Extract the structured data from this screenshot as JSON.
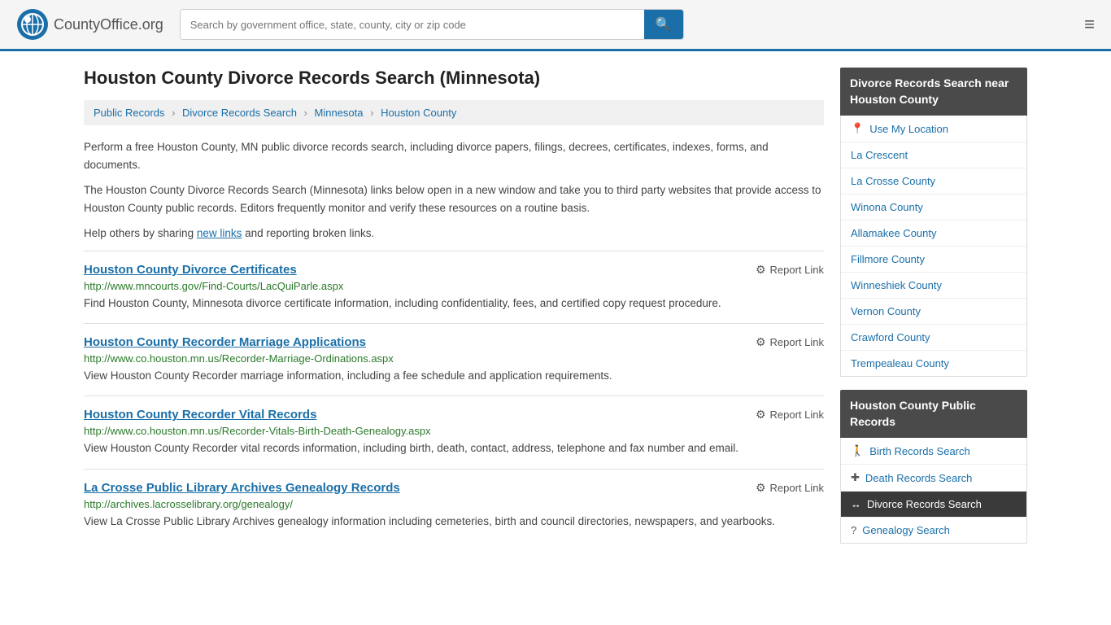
{
  "header": {
    "logo_text": "CountyOffice",
    "logo_suffix": ".org",
    "search_placeholder": "Search by government office, state, county, city or zip code"
  },
  "page": {
    "title": "Houston County Divorce Records Search (Minnesota)",
    "breadcrumb": [
      {
        "label": "Public Records",
        "href": "#"
      },
      {
        "label": "Divorce Records Search",
        "href": "#"
      },
      {
        "label": "Minnesota",
        "href": "#"
      },
      {
        "label": "Houston County",
        "href": "#"
      }
    ],
    "description1": "Perform a free Houston County, MN public divorce records search, including divorce papers, filings, decrees, certificates, indexes, forms, and documents.",
    "description2": "The Houston County Divorce Records Search (Minnesota) links below open in a new window and take you to third party websites that provide access to Houston County public records. Editors frequently monitor and verify these resources on a routine basis.",
    "description3_prefix": "Help others by sharing ",
    "new_links_text": "new links",
    "description3_suffix": " and reporting broken links."
  },
  "records": [
    {
      "title": "Houston County Divorce Certificates",
      "url": "http://www.mncourts.gov/Find-Courts/LacQuiParle.aspx",
      "description": "Find Houston County, Minnesota divorce certificate information, including confidentiality, fees, and certified copy request procedure."
    },
    {
      "title": "Houston County Recorder Marriage Applications",
      "url": "http://www.co.houston.mn.us/Recorder-Marriage-Ordinations.aspx",
      "description": "View Houston County Recorder marriage information, including a fee schedule and application requirements."
    },
    {
      "title": "Houston County Recorder Vital Records",
      "url": "http://www.co.houston.mn.us/Recorder-Vitals-Birth-Death-Genealogy.aspx",
      "description": "View Houston County Recorder vital records information, including birth, death, contact, address, telephone and fax number and email."
    },
    {
      "title": "La Crosse Public Library Archives Genealogy Records",
      "url": "http://archives.lacrosselibrary.org/genealogy/",
      "description": "View La Crosse Public Library Archives genealogy information including cemeteries, birth and council directories, newspapers, and yearbooks."
    }
  ],
  "report_label": "Report Link",
  "sidebar": {
    "nearby_header": "Divorce Records Search near Houston County",
    "nearby_items": [
      {
        "label": "Use My Location",
        "icon": "📍"
      },
      {
        "label": "La Crescent",
        "icon": ""
      },
      {
        "label": "La Crosse County",
        "icon": ""
      },
      {
        "label": "Winona County",
        "icon": ""
      },
      {
        "label": "Allamakee County",
        "icon": ""
      },
      {
        "label": "Fillmore County",
        "icon": ""
      },
      {
        "label": "Winneshiek County",
        "icon": ""
      },
      {
        "label": "Vernon County",
        "icon": ""
      },
      {
        "label": "Crawford County",
        "icon": ""
      },
      {
        "label": "Trempealeau County",
        "icon": ""
      }
    ],
    "public_records_header": "Houston County Public Records",
    "public_records_items": [
      {
        "label": "Birth Records Search",
        "icon": "🚶",
        "active": false
      },
      {
        "label": "Death Records Search",
        "icon": "✚",
        "active": false
      },
      {
        "label": "Divorce Records Search",
        "icon": "↔",
        "active": true
      },
      {
        "label": "Genealogy Search",
        "icon": "?",
        "active": false
      }
    ]
  }
}
